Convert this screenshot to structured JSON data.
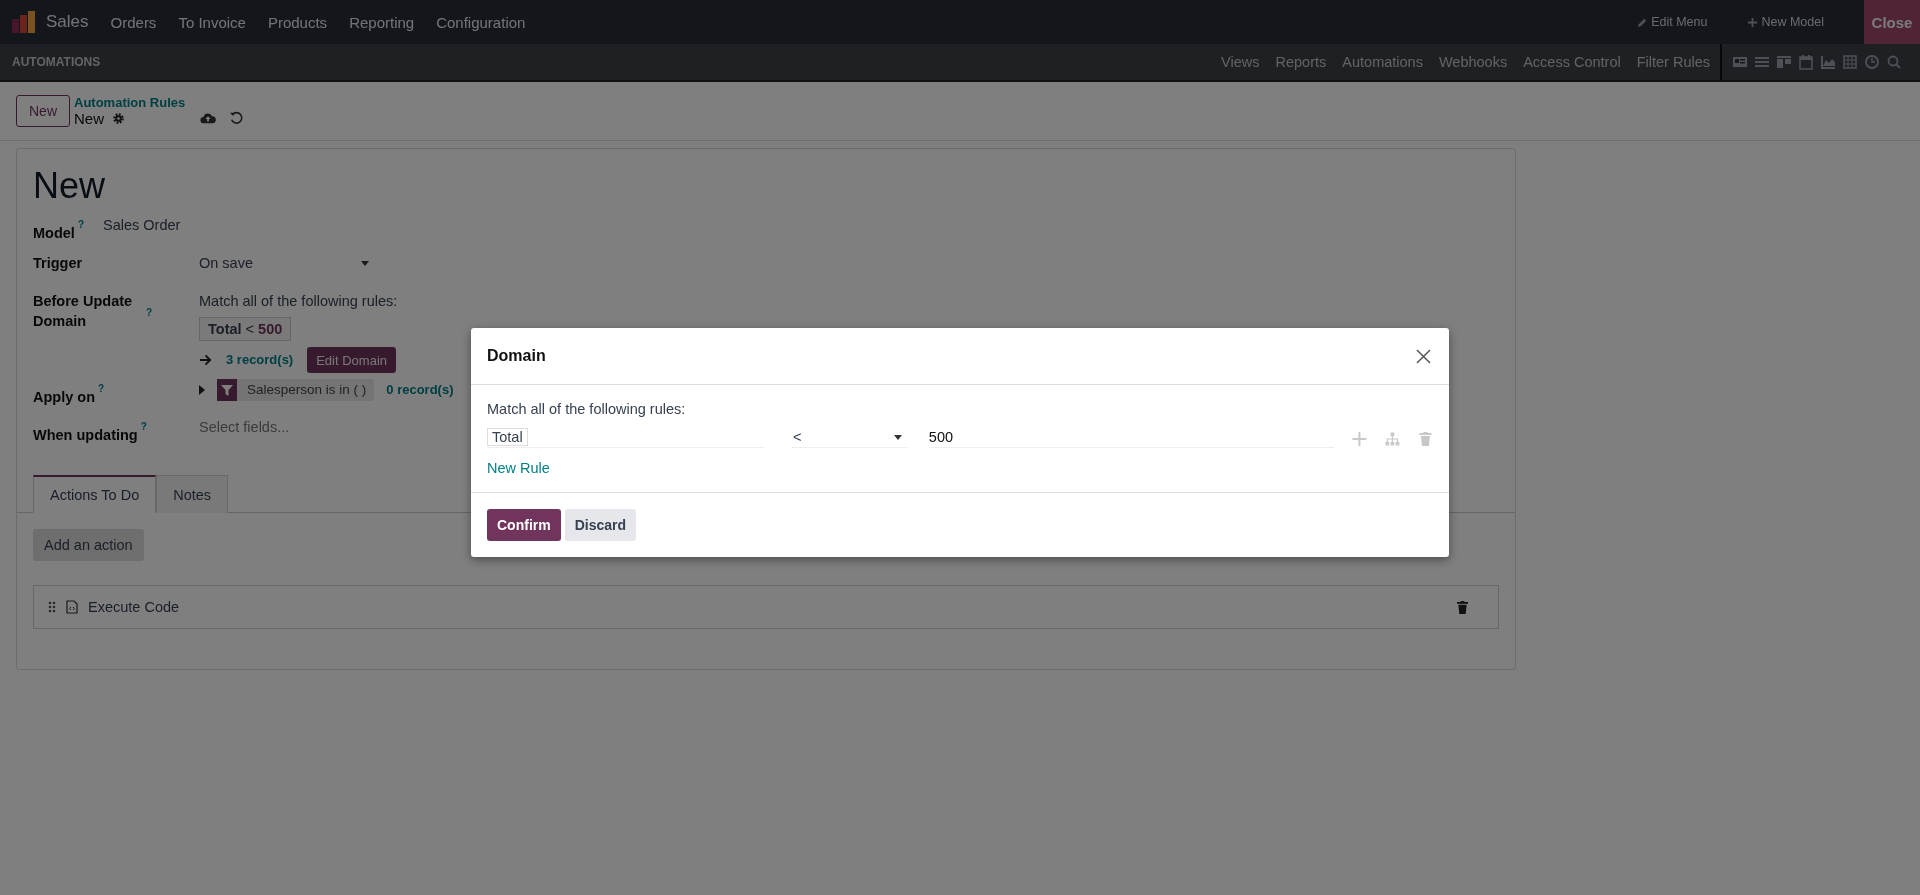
{
  "app_menu": {
    "app_name": "Sales",
    "items": [
      "Orders",
      "To Invoice",
      "Products",
      "Reporting",
      "Configuration"
    ]
  },
  "studio_actions": [
    {
      "label": "Edit Menu",
      "kind": "edit"
    },
    {
      "label": "New Model",
      "kind": "add"
    }
  ],
  "close_button": "Close",
  "studio_bar": {
    "title": "AUTOMATIONS",
    "items": [
      "Views",
      "Reports",
      "Automations",
      "Webhooks",
      "Access Control",
      "Filter Rules"
    ]
  },
  "control_panel": {
    "new_button": "New",
    "breadcrumb": "Automation Rules",
    "current": "New"
  },
  "form": {
    "title": "New",
    "fields": [
      {
        "kind": "text",
        "label": "Model",
        "help": "?",
        "value": "Sales Order"
      },
      {
        "kind": "select",
        "label": "Trigger",
        "value": "On save"
      },
      {
        "kind": "domain",
        "label": "Before Update Domain",
        "help": "?",
        "intro": "Match all of the following rules:",
        "tag_field": "Total",
        "tag_operator": "<",
        "tag_value": "500",
        "records": "3 record(s)",
        "button": "Edit Domain"
      },
      {
        "kind": "filter",
        "label": "Apply on",
        "help": "?",
        "filter": "Salesperson is in ( )",
        "records": "0 record(s)"
      },
      {
        "kind": "placeholder",
        "label": "When updating",
        "help": "?",
        "placeholder": "Select fields..."
      }
    ],
    "tabs": [
      {
        "label": "Actions To Do",
        "selected": true
      },
      {
        "label": "Notes",
        "selected": false
      }
    ],
    "add_action_button": "Add an action",
    "actions": [
      {
        "label": "Execute Code"
      }
    ]
  },
  "dialog": {
    "title": "Domain",
    "intro": "Match all of the following rules:",
    "rules": [
      {
        "field": "Total",
        "operator": "<",
        "value": "500"
      }
    ],
    "new_rule": "New Rule",
    "buttons": [
      {
        "label": "Confirm",
        "kind": "primary"
      },
      {
        "label": "Discard",
        "kind": "secondary"
      }
    ]
  }
}
